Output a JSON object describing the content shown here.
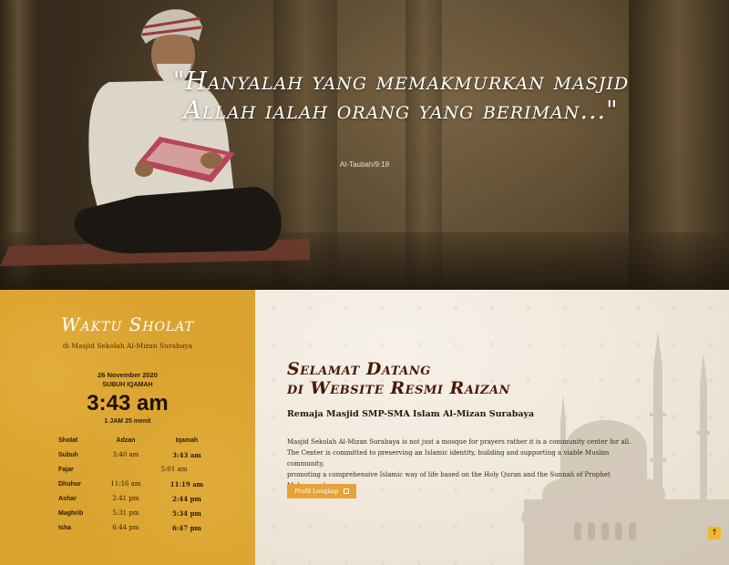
{
  "hero": {
    "quote": "\"Hanyalah yang memakmurkan masjid Allah ialah orang yang beriman...\"",
    "source": "At-Taubah/9:18"
  },
  "prayer": {
    "title": "Waktu Sholat",
    "subtitle": "di Masjid Sekolah Al-Mizan Surabaya",
    "date": "26 November 2020",
    "next_label": "SUBUH IQAMAH",
    "clock": "3:43 am",
    "remaining": "1 JAM 25 menit",
    "headers": [
      "Sholat",
      "Adzan",
      "Iqamah"
    ],
    "rows": [
      {
        "name": "Subuh",
        "adzan": "3:40 am",
        "iqamah": "3:43 am"
      },
      {
        "name": "Fajar",
        "adzan": "5:01 am",
        "iqamah": ""
      },
      {
        "name": "Dhuhur",
        "adzan": "11:16 am",
        "iqamah": "11:19 am"
      },
      {
        "name": "Ashar",
        "adzan": "2:41 pm",
        "iqamah": "2:44 pm"
      },
      {
        "name": "Maghrib",
        "adzan": "5:31 pm",
        "iqamah": "5:34 pm"
      },
      {
        "name": "Isha",
        "adzan": "6:44 pm",
        "iqamah": "6:47 pm"
      }
    ]
  },
  "welcome": {
    "title_line1": "Selamat Datang",
    "title_line2": "di Website Resmi Raizan",
    "subtitle": "Remaja Masjid SMP-SMA Islam Al-Mizan Surabaya",
    "desc_line1": "Masjid Sekolah Al-Mizan Surabaya is not just a mosque for prayers rather it is a community center for all.",
    "desc_line2": "The Center is committed to preserving an Islamic identity, building and supporting a viable Muslim community,",
    "desc_line3": "promoting a comprehensive Islamic way of life based on the Holy Quran and the Sunnah of Prophet Muhammad.",
    "button_label": "Profil Lengkap"
  },
  "scroll_top_icon": "arrow-up-icon",
  "colors": {
    "panel_gold": "#dba32f",
    "title_maroon": "#4a1808",
    "button_orange": "#e8a23a"
  }
}
